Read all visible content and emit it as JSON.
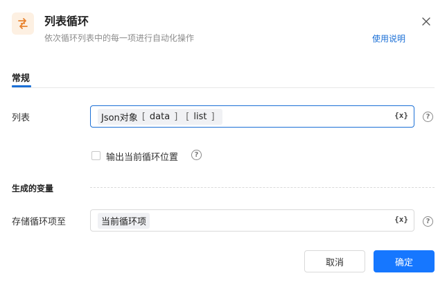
{
  "header": {
    "title": "列表循环",
    "subtitle": "依次循环列表中的每一项进行自动化操作",
    "help_link": "使用说明",
    "icon": "list-loop-icon",
    "icon_color": "#e8822e"
  },
  "tabs": [
    {
      "label": "常规",
      "active": true
    }
  ],
  "fields": {
    "list": {
      "label": "列表",
      "token_prefix": "Json对象",
      "token_keys": [
        "data",
        "list"
      ],
      "var_button": "{x}",
      "help": "?"
    },
    "output_position": {
      "label": "输出当前循环位置",
      "checked": false,
      "help": "?"
    }
  },
  "variables_section": {
    "title": "生成的变量",
    "store_item": {
      "label": "存储循环项至",
      "token": "当前循环项",
      "var_button": "{x}",
      "help": "?"
    }
  },
  "footer": {
    "cancel_label": "取消",
    "ok_label": "确定"
  },
  "colors": {
    "accent": "#1677ff",
    "link": "#1a6fd6"
  }
}
